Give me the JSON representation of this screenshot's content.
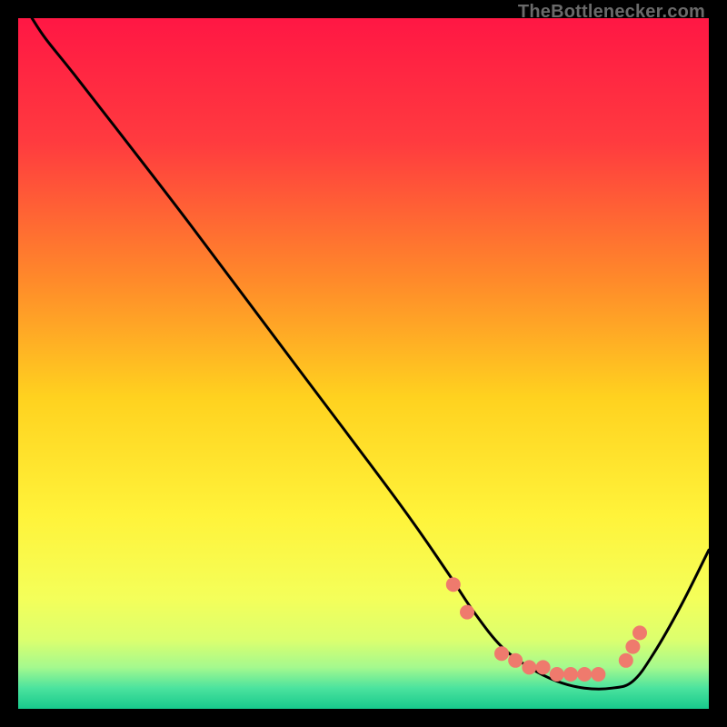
{
  "attribution": "TheBottlenecker.com",
  "chart_data": {
    "type": "line",
    "title": "",
    "xlabel": "",
    "ylabel": "",
    "xlim": [
      0,
      100
    ],
    "ylim": [
      0,
      100
    ],
    "grid": false,
    "legend": false,
    "gradient_stops": [
      {
        "offset": 0,
        "color": "#ff1744"
      },
      {
        "offset": 0.18,
        "color": "#ff3b3f"
      },
      {
        "offset": 0.38,
        "color": "#ff8a2a"
      },
      {
        "offset": 0.55,
        "color": "#ffd21f"
      },
      {
        "offset": 0.72,
        "color": "#fff33a"
      },
      {
        "offset": 0.84,
        "color": "#f4ff5a"
      },
      {
        "offset": 0.9,
        "color": "#dcff6e"
      },
      {
        "offset": 0.94,
        "color": "#a4f98e"
      },
      {
        "offset": 0.97,
        "color": "#4be39e"
      },
      {
        "offset": 1.0,
        "color": "#17c98c"
      }
    ],
    "series": [
      {
        "name": "bottleneck-curve",
        "color": "#000000",
        "x": [
          2,
          4,
          8,
          15,
          25,
          40,
          55,
          62,
          66,
          70,
          74,
          78,
          82,
          86,
          89,
          92,
          96,
          100
        ],
        "y": [
          100,
          97,
          92,
          83,
          70,
          50,
          30,
          20,
          14,
          9,
          6,
          4,
          3,
          3,
          4,
          8,
          15,
          23
        ]
      }
    ],
    "markers": {
      "name": "salmon-dots",
      "color": "#ef7a6d",
      "radius_px": 8,
      "points": [
        {
          "x": 63,
          "y": 18
        },
        {
          "x": 65,
          "y": 14
        },
        {
          "x": 70,
          "y": 8
        },
        {
          "x": 72,
          "y": 7
        },
        {
          "x": 74,
          "y": 6
        },
        {
          "x": 76,
          "y": 6
        },
        {
          "x": 78,
          "y": 5
        },
        {
          "x": 80,
          "y": 5
        },
        {
          "x": 82,
          "y": 5
        },
        {
          "x": 84,
          "y": 5
        },
        {
          "x": 88,
          "y": 7
        },
        {
          "x": 89,
          "y": 9
        },
        {
          "x": 90,
          "y": 11
        }
      ]
    }
  }
}
